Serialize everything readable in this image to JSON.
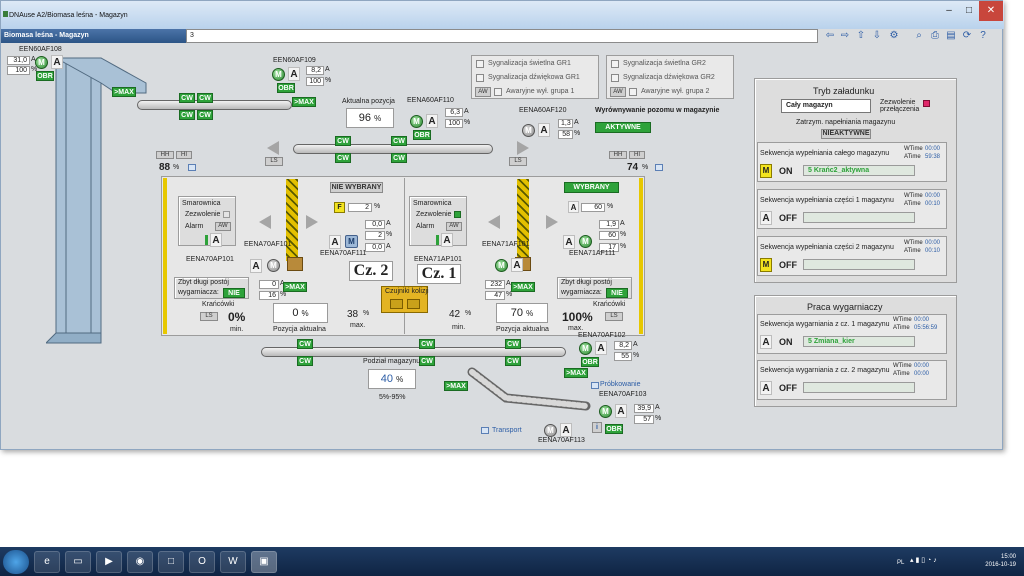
{
  "window": {
    "title": "DNAuse A2/Biomasa leśna - Magazyn",
    "header": "Biomasa leśna - Magazyn",
    "address_value": "3"
  },
  "devices": {
    "af108": {
      "name": "EEN60AF108",
      "current": "31,0",
      "unit": "A",
      "percent": "100",
      "pct_unit": "%",
      "obr": "OBR"
    },
    "af109": {
      "name": "EEN60AF109",
      "current": "8,2",
      "unit": "A",
      "percent": "100",
      "pct_unit": "%",
      "obr": "OBR"
    },
    "af110": {
      "name": "EENA60AF110",
      "current": "6,3",
      "unit": "A",
      "percent": "100",
      "pct_unit": "%",
      "obr": "OBR"
    },
    "af120": {
      "name": "EENA60AF120",
      "current": "1,3",
      "unit": "A",
      "percent": "58",
      "pct_unit": "%"
    },
    "af101": {
      "name": "EENA70AF101",
      "current": "0",
      "unit": "A",
      "percent": "16",
      "pct_unit": "%"
    },
    "ap101": {
      "name": "EENA70AP101"
    },
    "af111": {
      "name": "EENA70AF111",
      "v1": "0,0",
      "v2": "2",
      "v3": "0,0",
      "unit": "A",
      "pct_unit": "%"
    },
    "af71_101": {
      "name": "EENA71AF101",
      "current": "232",
      "unit": "A",
      "percent": "47",
      "pct_unit": "%"
    },
    "ap71_101": {
      "name": "EENA71AP101"
    },
    "af71_111": {
      "name": "EENA71AF111",
      "v1": "1,9",
      "v2": "60",
      "v3": "17",
      "unit": "A",
      "pct_unit": "%"
    },
    "af102": {
      "name": "EENA70AF102",
      "current": "8,2",
      "unit": "A",
      "percent": "55",
      "pct_unit": "%",
      "obr": "OBR"
    },
    "af103": {
      "name": "EENA70AF103",
      "current": "39,9",
      "unit": "A",
      "percent": "57",
      "pct_unit": "%",
      "obr": "OBR"
    },
    "af113": {
      "name": "EENA70AF113"
    }
  },
  "labels": {
    "max": ">MAX",
    "cw": "CW",
    "motor": "M",
    "auto": "A",
    "ls": "LS",
    "hh": "HH",
    "hi": "HI",
    "aw": "AW",
    "info": "i",
    "F": "F"
  },
  "level": {
    "current_label": "Aktualna pozycja",
    "current_value": "96",
    "left_value": "88",
    "right_value": "74",
    "unit": "%"
  },
  "signal_gr1": {
    "light": "Sygnalizacja świetlna GR1",
    "sound": "Sygnalizacja dźwiękowa GR1",
    "fault": "Awaryjne wył. grupa 1"
  },
  "signal_gr2": {
    "light": "Sygnalizacja świetlna GR2",
    "sound": "Sygnalizacja dźwiękowa GR2",
    "fault": "Awaryjne wył. grupa 2"
  },
  "leveling": {
    "label": "Wyrównywanie pozomu w magazynie",
    "state": "AKTYWNE"
  },
  "silo2": {
    "state": "NIE WYBRANY",
    "f_value": "2",
    "smar_title": "Smarownica",
    "zezwolenie": "Zezwolenie",
    "alarm": "Alarm",
    "name": "Cz. 2",
    "too_long": "Zbyt długi postój",
    "wyg": "wygarniacza:",
    "wyg_state": "NIE",
    "krancowki": "Krańcówki",
    "min_value": "0%",
    "min_label": "min.",
    "pos_value": "0",
    "pos_label": "Pozycja aktualna",
    "max_value": "38",
    "max_label": "max."
  },
  "silo1": {
    "state": "WYBRANY",
    "pct": "60",
    "smar_title": "Smarownica",
    "zezwolenie": "Zezwolenie",
    "alarm": "Alarm",
    "name": "Cz. 1",
    "too_long": "Zbyt długi postój",
    "wyg": "wygarniacza:",
    "wyg_state": "NIE",
    "krancowki": "Krańcówki",
    "min_value": "42",
    "min_label": "min.",
    "pos_value": "70",
    "pos_label": "Pozycja aktualna",
    "max_value": "100%",
    "max_label": "max."
  },
  "collision": {
    "label": "Czujniki kolizji"
  },
  "distribution": {
    "label": "Podział magazynu",
    "value": "40",
    "unit": "%",
    "range": "5%-95%"
  },
  "links": {
    "sampling": "Próbkowanie",
    "transport": "Transport"
  },
  "loading": {
    "title": "Tryb załadunku",
    "select_value": "Cały magazyn",
    "permit": "Zezwolenie przełączenia",
    "stop_label": "Zatrzym. napełniania magazynu",
    "stop_state": "NIEAKTYWNE",
    "sequences": [
      {
        "title": "Sekwencja wypełniania całego magazynu",
        "mode": "M",
        "state": "ON",
        "value": "5 Krańc2_aktywna",
        "wtime": "00:00",
        "atime": "59:38"
      },
      {
        "title": "Sekwencja wypełniania części 1 magazynu",
        "mode": "A",
        "state": "OFF",
        "value": "",
        "wtime": "00:00",
        "atime": "00:10"
      },
      {
        "title": "Sekwencja wypełniania części 2 magazynu",
        "mode": "M",
        "state": "OFF",
        "value": "",
        "wtime": "00:00",
        "atime": "00:10"
      }
    ]
  },
  "raking": {
    "title": "Praca wygarniaczy",
    "sequences": [
      {
        "title": "Sekwencja wygarniania z cz. 1 magazynu",
        "mode": "A",
        "state": "ON",
        "value": "5 Zmiana_kier",
        "wtime": "00:00",
        "atime": "05:56:59"
      },
      {
        "title": "Sekwencja wygarniania z cz. 2 magazynu",
        "mode": "A",
        "state": "OFF",
        "value": "",
        "wtime": "00:00",
        "atime": "00:00"
      }
    ],
    "wtime_label": "WTime",
    "atime_label": "ATime"
  },
  "taskbar": {
    "lang": "PL",
    "time": "15:00",
    "date": "2016-10-19"
  },
  "colors": {
    "accent_green": "#2ea23a",
    "header_blue": "#2c5586",
    "yellow": "#e7c800"
  }
}
